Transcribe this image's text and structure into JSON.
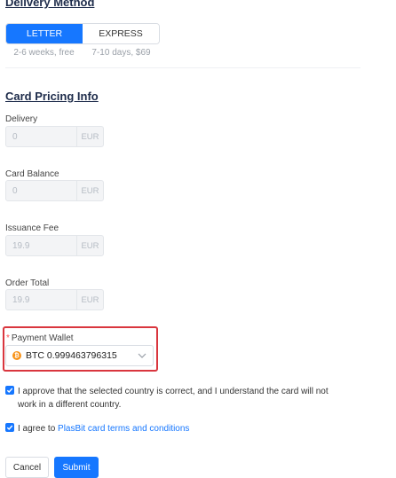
{
  "delivery": {
    "title": "Delivery Method",
    "options": [
      {
        "label": "LETTER",
        "hint": "2-6 weeks, free",
        "selected": true
      },
      {
        "label": "EXPRESS",
        "hint": "7-10 days, $69",
        "selected": false
      }
    ]
  },
  "pricing": {
    "title": "Card Pricing Info",
    "fields": [
      {
        "label": "Delivery",
        "value": "0",
        "unit": "EUR"
      },
      {
        "label": "Card Balance",
        "value": "0",
        "unit": "EUR"
      },
      {
        "label": "Issuance Fee",
        "value": "19.9",
        "unit": "EUR"
      },
      {
        "label": "Order Total",
        "value": "19.9",
        "unit": "EUR"
      }
    ]
  },
  "wallet": {
    "required_mark": "*",
    "label": "Payment Wallet",
    "currency_icon": "bitcoin-icon",
    "selected_value": "BTC 0.999463796315"
  },
  "agreements": {
    "country_text": "I approve that the selected country is correct, and I understand the card will not work in a different country.",
    "terms_prefix": "I agree to ",
    "terms_link": "PlasBit card terms and conditions"
  },
  "actions": {
    "cancel_label": "Cancel",
    "submit_label": "Submit"
  },
  "colors": {
    "primary": "#1677ff",
    "highlight_border": "#d9363e",
    "bitcoin": "#f7931a"
  }
}
